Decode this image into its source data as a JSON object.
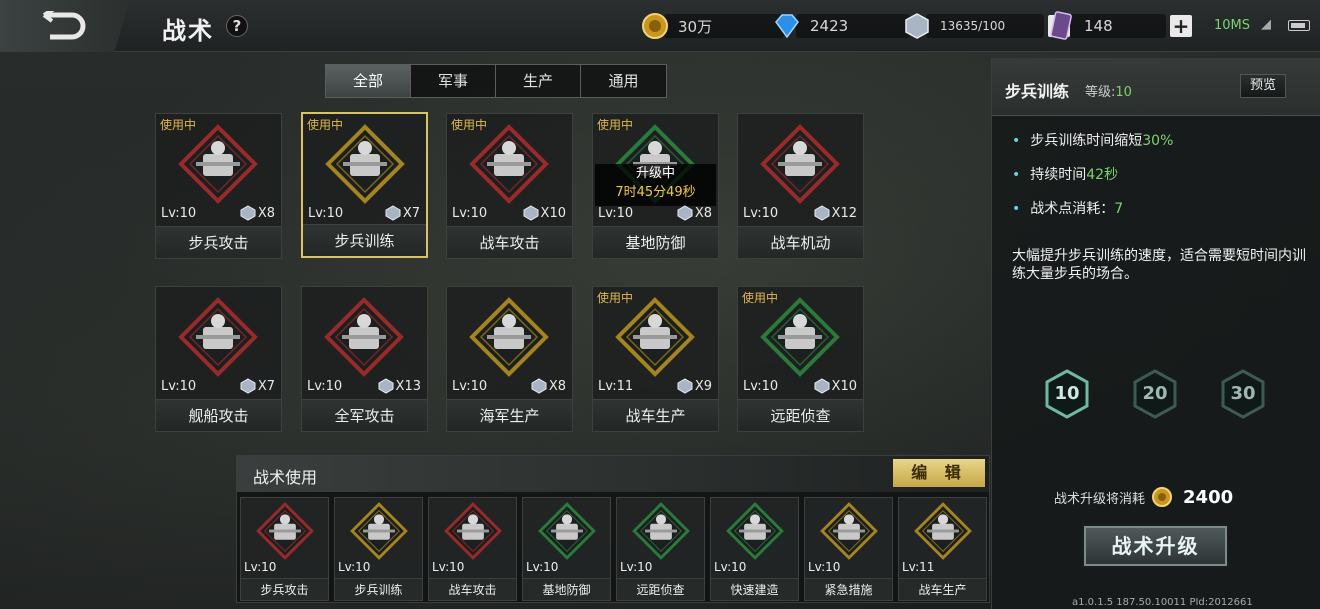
{
  "header": {
    "back_icon": "back-arrow-icon",
    "title": "战术",
    "help": "?"
  },
  "resources": {
    "gold": "30万",
    "diamond": "2423",
    "crystal": "13635/100",
    "card": "148",
    "network": "10MS"
  },
  "tabs": [
    {
      "label": "全部",
      "active": true
    },
    {
      "label": "军事"
    },
    {
      "label": "生产"
    },
    {
      "label": "通用"
    }
  ],
  "in_use_label": "使用中",
  "tactics": [
    {
      "name": "步兵攻击",
      "lv": "Lv:10",
      "cost": "X8",
      "in_use": true,
      "color": "#9a2a2a",
      "icon": "soldier-rifle-icon"
    },
    {
      "name": "步兵训练",
      "lv": "Lv:10",
      "cost": "X7",
      "in_use": true,
      "selected": true,
      "color": "#a38420",
      "icon": "soldier-running-icon"
    },
    {
      "name": "战车攻击",
      "lv": "Lv:10",
      "cost": "X10",
      "in_use": true,
      "color": "#9a2a2a",
      "icon": "tank-firing-icon"
    },
    {
      "name": "基地防御",
      "lv": "Lv:10",
      "cost": "X8",
      "in_use": true,
      "color": "#2a7a3a",
      "icon": "fortress-icon",
      "upgrading": "升级中",
      "timer": "7时45分49秒"
    },
    {
      "name": "战车机动",
      "lv": "Lv:10",
      "cost": "X12",
      "in_use": false,
      "color": "#9a2a2a",
      "icon": "tank-icon"
    },
    {
      "name": "舰船攻击",
      "lv": "Lv:10",
      "cost": "X7",
      "in_use": false,
      "color": "#9a2a2a",
      "icon": "warship-icon"
    },
    {
      "name": "全军攻击",
      "lv": "Lv:10",
      "cost": "X13",
      "in_use": false,
      "color": "#9a2a2a",
      "icon": "soldier-icon"
    },
    {
      "name": "海军生产",
      "lv": "Lv:10",
      "cost": "X8",
      "in_use": false,
      "color": "#a38420",
      "icon": "ship-gear-icon"
    },
    {
      "name": "战车生产",
      "lv": "Lv:11",
      "cost": "X9",
      "in_use": true,
      "color": "#a38420",
      "icon": "tank-gear-icon"
    },
    {
      "name": "远距侦查",
      "lv": "Lv:10",
      "cost": "X10",
      "in_use": true,
      "color": "#2a7a3a",
      "icon": "scout-icon"
    }
  ],
  "used_panel": {
    "title": "战术使用",
    "edit": "编 辑",
    "items": [
      {
        "name": "步兵攻击",
        "lv": "Lv:10",
        "color": "#9a2a2a"
      },
      {
        "name": "步兵训练",
        "lv": "Lv:10",
        "color": "#a38420"
      },
      {
        "name": "战车攻击",
        "lv": "Lv:10",
        "color": "#9a2a2a"
      },
      {
        "name": "基地防御",
        "lv": "Lv:10",
        "color": "#2a7a3a"
      },
      {
        "name": "远距侦查",
        "lv": "Lv:10",
        "color": "#2a7a3a"
      },
      {
        "name": "快速建造",
        "lv": "Lv:10",
        "color": "#2a7a3a"
      },
      {
        "name": "紧急措施",
        "lv": "Lv:10",
        "color": "#a38420"
      },
      {
        "name": "战车生产",
        "lv": "Lv:11",
        "color": "#a38420"
      }
    ]
  },
  "detail": {
    "name": "步兵训练",
    "level_label": "等级:",
    "level": "10",
    "preview": "预览",
    "e1_pre": "步兵训练时间缩短",
    "e1_val": "30%",
    "e2_pre": "持续时间",
    "e2_val": "42秒",
    "e3_pre": "战术点消耗：",
    "e3_val": "7",
    "desc": "大幅提升步兵训练的速度，适合需要短时间内训练大量步兵的场合。",
    "levels": [
      "10",
      "20",
      "30"
    ],
    "cost_label": "战术升级将消耗",
    "cost": "2400",
    "upgrade": "战术升级"
  },
  "version": "a1.0.1.5 187.50.10011 PId:2012661"
}
